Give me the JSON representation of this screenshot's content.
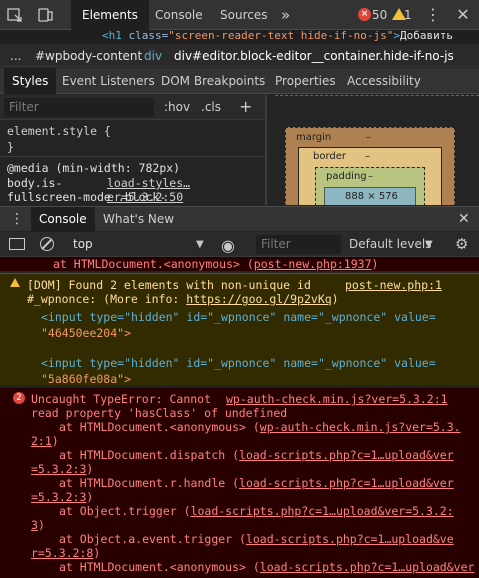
{
  "top_tabs": {
    "elements": "Elements",
    "console": "Console",
    "sources": "Sources",
    "more": "»"
  },
  "counts": {
    "errors": "50",
    "warnings": "1"
  },
  "code_line": {
    "tag_open": "<h1",
    "attr": "class=",
    "value": "\"screen-reader-text hide-if-no-js\"",
    "tag_close": ">",
    "text": "Добавить"
  },
  "breadcrumbs": {
    "ellipsis": "...",
    "item1": "#wpbody-content",
    "item2": "div",
    "item3": "div#editor.block-editor__container.hide-if-no-js"
  },
  "style_tabs": {
    "styles": "Styles",
    "listeners": "Event Listeners",
    "dom_breakpoints": "DOM Breakpoints",
    "properties": "Properties",
    "accessibility": "Accessibility"
  },
  "styles_filter": {
    "placeholder": "Filter",
    "hov": ":hov",
    "cls": ".cls",
    "add": "+"
  },
  "styles_pane": {
    "element_style": "element.style {",
    "close_brace": "}",
    "media": "@media (min-width: 782px)",
    "selector1": "body.is-",
    "selector2": "fullscreen-mode .block-",
    "source": "load-styles…er=5.3.2:50"
  },
  "box_model": {
    "margin": "margin",
    "margin_val": "–",
    "border": "border",
    "border_val": "–",
    "padding": "padding",
    "padding_val": "–",
    "content": "888 × 576"
  },
  "drawer": {
    "console": "Console",
    "whats_new": "What's New"
  },
  "console_toolbar": {
    "context": "top",
    "filter_placeholder": "Filter",
    "levels": "Default levels"
  },
  "messages": {
    "prev_error_tail": {
      "text": "at HTMLDocument.<anonymous>",
      "link": "post-new.php:1937"
    },
    "warning": {
      "text1": "[DOM] Found 2 elements with non-unique id",
      "link": "post-new.php:1",
      "text2": "#_wpnonce: (More info:",
      "url": "https://goo.gl/9p2vKq",
      "text2_end": ")",
      "input1": "<input type=\"hidden\" id=\"_wpnonce\" name=\"_wpnonce\" value=",
      "input1_val": "\"46450ee204\">",
      "input2": "<input type=\"hidden\" id=\"_wpnonce\" name=\"_wpnonce\" value=",
      "input2_val": "\"5a860fe08a\">"
    },
    "error": {
      "badge": "2",
      "line1": "Uncaught TypeError: Cannot",
      "src1": "wp-auth-check.min.js?ver=5.3.2:1",
      "line2": "read property 'hasClass' of undefined",
      "f1": "at HTMLDocument.<anonymous> (",
      "f1_link_a": "wp-auth-check.min.js?ver=5.3.",
      "f1_link_b": "2:1",
      "f1_end": ")",
      "f2": "at HTMLDocument.dispatch (",
      "f2_link_a": "load-scripts.php?c=1…upload&ver",
      "f2_link_b": "=5.3.2:3",
      "f2_end": ")",
      "f3": "at HTMLDocument.r.handle (",
      "f3_link_a": "load-scripts.php?c=1…upload&ver",
      "f3_link_b": "=5.3.2:3",
      "f3_end": ")",
      "f4": "at Object.trigger (",
      "f4_link_a": "load-scripts.php?c=1…upload&ver=5.3.2:",
      "f4_link_b": "3",
      "f4_end": ")",
      "f5": "at Object.a.event.trigger (",
      "f5_link_a": "load-scripts.php?c=1…upload&ve",
      "f5_link_b": "r=5.3.2:8",
      "f5_end": ")",
      "f6": "at HTMLDocument.<anonymous> (",
      "f6_link_a": "load-scripts.php?c=1…upload&ver"
    }
  },
  "colors": {
    "error": "#ff8080",
    "warning": "#ffdd9e",
    "accent": "#4d9ff5"
  }
}
